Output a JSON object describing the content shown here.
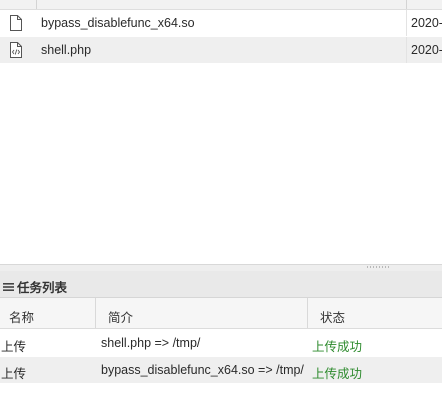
{
  "file_list": {
    "rows": [
      {
        "icon": "file-icon",
        "name": "bypass_disablefunc_x64.so",
        "date": "2020-"
      },
      {
        "icon": "code-file-icon",
        "name": "shell.php",
        "date": "2020-"
      }
    ]
  },
  "task_panel": {
    "title": "任务列表",
    "columns": {
      "name": "名称",
      "desc": "简介",
      "status": "状态"
    },
    "rows": [
      {
        "name": "上传",
        "desc": "shell.php => /tmp/",
        "status": "上传成功"
      },
      {
        "name": "上传",
        "desc": "bypass_disablefunc_x64.so => /tmp/",
        "status": "上传成功"
      }
    ]
  },
  "colors": {
    "success": "#2e8b2e",
    "row_alt": "#efefef"
  }
}
